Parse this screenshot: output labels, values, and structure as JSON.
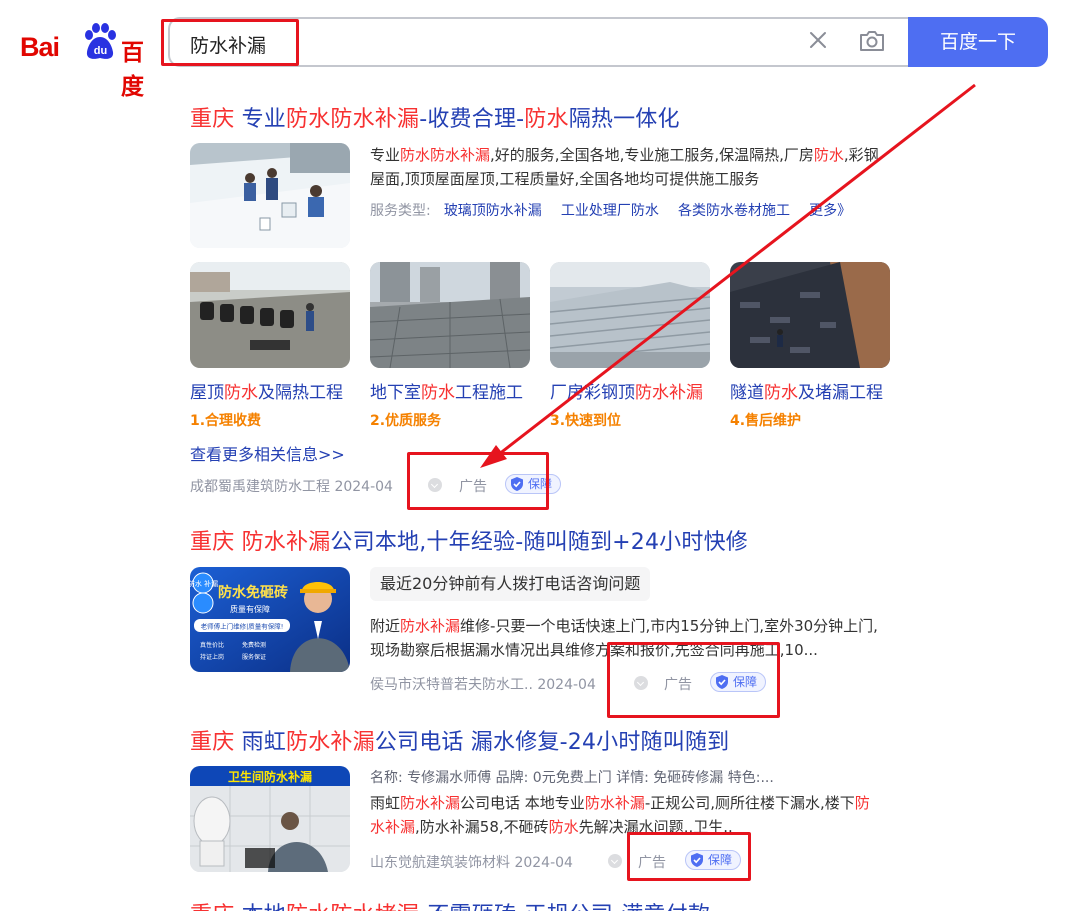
{
  "header": {
    "logo_bai": "Bai",
    "logo_du": "du",
    "logo_cn": "百度",
    "search_query": "防水补漏",
    "search_button": "百度一下"
  },
  "results": [
    {
      "title_parts": [
        "重庆",
        " 专业",
        "防水防水补漏",
        "-收费合理-",
        "防水",
        "隔热一体化"
      ],
      "snippet_parts": [
        "专业",
        "防水防水补漏",
        ",好的服务,全国各地,专业施工服务,保温隔热,厂房",
        "防水",
        ",彩钢屋面,顶顶屋面屋顶,工程质量好,全国各地均可提供施工服务"
      ],
      "service_label": "服务类型:",
      "service_links": [
        "玻璃顶防水补漏",
        "工业处理厂防水",
        "各类防水卷材施工",
        "更多》"
      ],
      "subitems": [
        {
          "title_parts": [
            "屋顶",
            "防水",
            "及隔热工程"
          ],
          "tag": "1.合理收费"
        },
        {
          "title_parts": [
            "地下室",
            "防水",
            "工程施工"
          ],
          "tag": "2.优质服务"
        },
        {
          "title_parts": [
            "厂房彩钢顶",
            "防水补漏",
            ""
          ],
          "tag": "3.快速到位"
        },
        {
          "title_parts": [
            "隧道",
            "防水",
            "及堵漏工程"
          ],
          "tag": "4.售后维护"
        }
      ],
      "more_link": "查看更多相关信息>>",
      "source": "成都蜀禹建筑防水工程  2024-04",
      "ad_label": "广告",
      "guarantee": "保障"
    },
    {
      "title_parts": [
        "重庆",
        " ",
        "防水补漏",
        "公司本地,十年经验-随叫随到+24小时快修"
      ],
      "image_text": {
        "badge1": "防水 补漏",
        "headline": "防水免砸砖",
        "sub": "质量有保障",
        "banner": "老师傅上门维修|质量有保障!",
        "bullets": [
          "真性价比",
          "免费检测",
          "持证上岗",
          "服务保证"
        ]
      },
      "gray_tag": "最近20分钟前有人拨打电话咨询问题",
      "snippet_parts": [
        "附近",
        "防水补漏",
        "维修-只要一个电话快速上门,市内15分钟上门,室外30分钟上门,现场勘察后根据漏水情况出具维修方案和报价,先签合同再施工,10..."
      ],
      "source": "侯马市沃特普若夫防水工..  2024-04",
      "ad_label": "广告",
      "guarantee": "保障"
    },
    {
      "title_parts": [
        "重庆",
        " 雨虹",
        "防水补漏",
        "公司电话 漏水修复-24小时随叫随到"
      ],
      "image_text": {
        "banner": "卫生间防水补漏"
      },
      "attrs": "名称: 专修漏水师傅    品牌: 0元免费上门    详情: 免砸砖修漏    特色:...",
      "snippet_parts": [
        "雨虹",
        "防水补漏",
        "公司电话 本地专业",
        "防水补漏",
        "-正规公司,厕所往楼下漏水,楼下",
        "防水补漏",
        ",防水补漏58,不砸砖",
        "防水",
        "先解决漏水问题,,卫生.."
      ],
      "source": "山东觉航建筑装饰材料  2024-04",
      "ad_label": "广告",
      "guarantee": "保障"
    },
    {
      "title_parts": [
        "重庆",
        " 本地",
        "防水防水堵漏",
        "-不需砸砖-正规公司-满意付款"
      ]
    }
  ],
  "colors": {
    "brand_red": "#e10601",
    "brand_blue": "#2932e1",
    "link_blue": "#2440b3",
    "highlight_red": "#f73131",
    "button_blue": "#4e6ef2",
    "annotation_red": "#e6141e",
    "tag_orange": "#f58100"
  }
}
